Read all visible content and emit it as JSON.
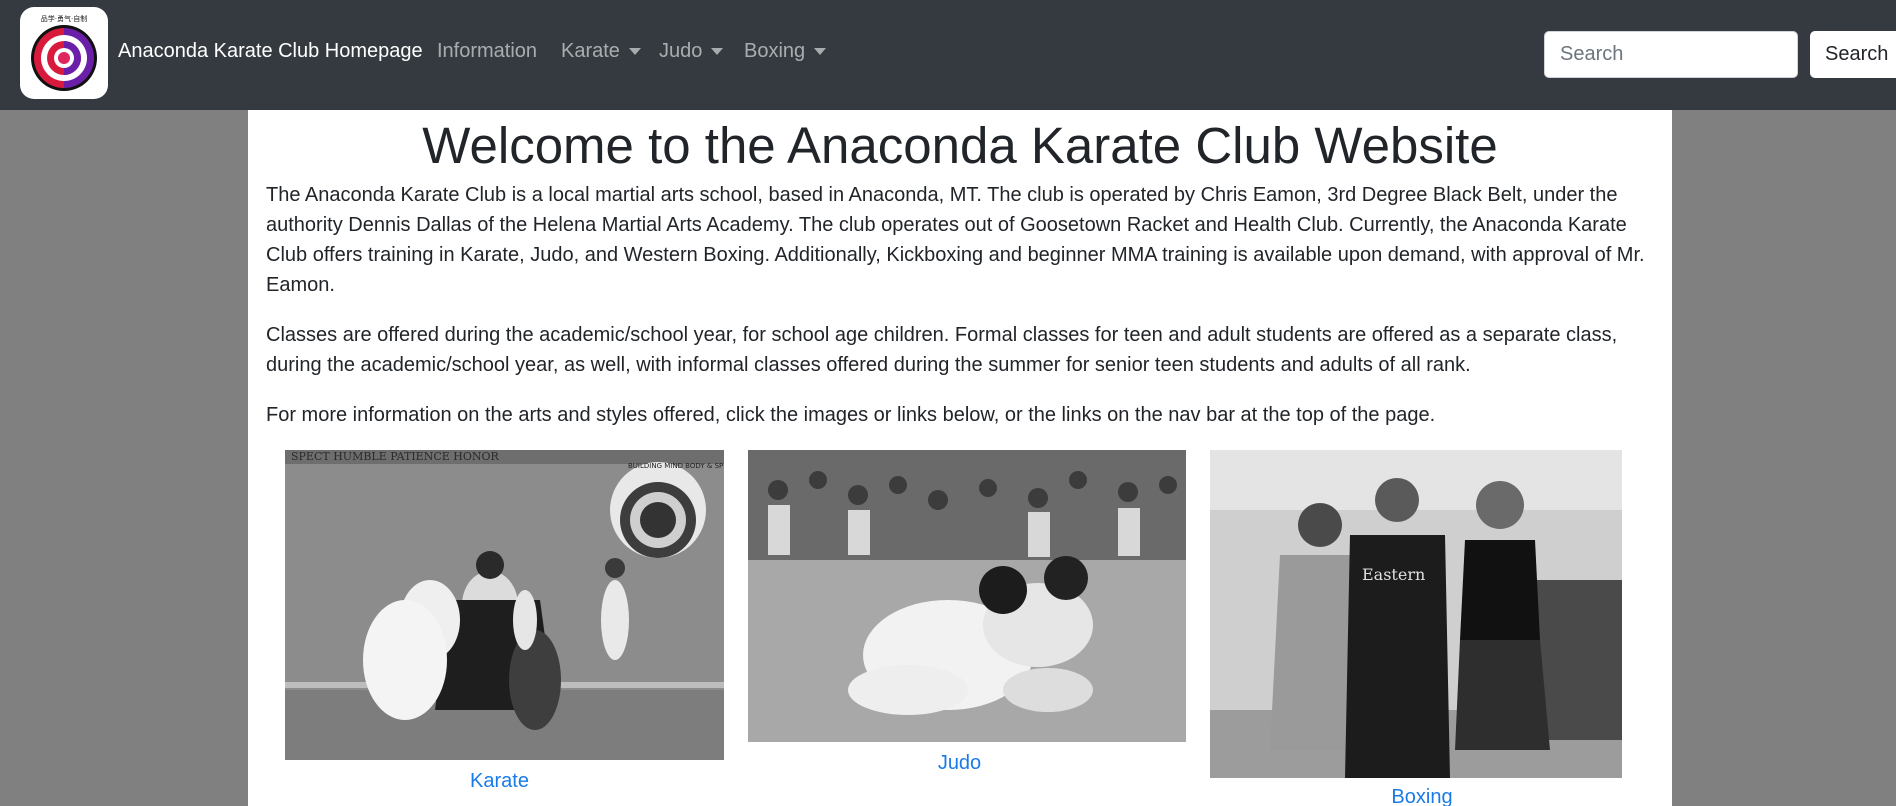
{
  "navbar": {
    "brand": "Anaconda Karate Club Homepage",
    "logo_text": "品学·勇气·自制",
    "links": [
      {
        "label": "Information",
        "dropdown": false
      },
      {
        "label": "Karate",
        "dropdown": true
      },
      {
        "label": "Judo",
        "dropdown": true
      },
      {
        "label": "Boxing",
        "dropdown": true
      }
    ],
    "search_placeholder": "Search",
    "search_button": "Search"
  },
  "main": {
    "title": "Welcome to the Anaconda Karate Club Website",
    "paragraphs": [
      "The Anaconda Karate Club is a local martial arts school, based in Anaconda, MT. The club is operated by Chris Eamon, 3rd Degree Black Belt, under the authority Dennis Dallas of the Helena Martial Arts Academy. The club operates out of Goosetown Racket and Health Club. Currently, the Anaconda Karate Club offers training in Karate, Judo, and Western Boxing. Additionally, Kickboxing and beginner MMA training is available upon demand, with approval of Mr. Eamon.",
      "Classes are offered during the academic/school year, for school age children. Formal classes for teen and adult students are offered as a separate class, during the academic/school year, as well, with informal classes offered during the summer for senior teen students and adults of all rank.",
      "For more information on the arts and styles offered, click the images or links below, or the links on the nav bar at the top of the page."
    ],
    "cards": [
      {
        "label": "Karate",
        "poster_text": "BUILDING MIND BODY & SPIRIT",
        "banner_text": "SPECT   HUMBLE   PATIENCE   HONOR"
      },
      {
        "label": "Judo"
      },
      {
        "label": "Boxing",
        "shirt_text": "Eastern"
      }
    ]
  },
  "colors": {
    "navbar_bg": "#343a40",
    "page_bg": "#808080",
    "link": "#1a7be8"
  }
}
